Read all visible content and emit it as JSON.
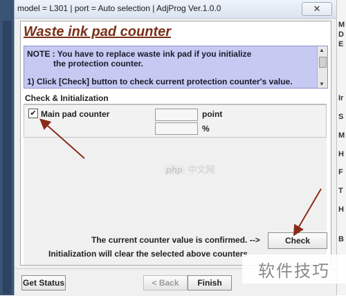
{
  "window": {
    "title": "model = L301 | port = Auto selection | AdjProg Ver.1.0.0",
    "close_glyph": "✕"
  },
  "heading": "Waste ink pad counter",
  "note": {
    "line1": "NOTE : You have to replace waste ink pad if you initialize",
    "line2": "the protection counter.",
    "line3": "1) Click [Check] button to check current protection counter's value."
  },
  "section": {
    "label": "Check & Initialization",
    "rows": [
      {
        "checked": true,
        "check_glyph": "✔",
        "label": "Main pad counter",
        "value1": "",
        "unit1": "point",
        "value2": "",
        "unit2": "%"
      }
    ]
  },
  "confirm_text": "The current counter value is confirmed. -->",
  "check_button": "Check",
  "init_text": "Initialization will clear the selected above counters",
  "bottom": {
    "get_status": "Get Status",
    "back": "< Back",
    "finish": "Finish"
  },
  "right_panel_letters": [
    "M",
    "D",
    "E",
    "Ir",
    "S",
    "M",
    "H",
    "F",
    "T",
    "H",
    "B"
  ],
  "watermarks": {
    "center_logo": "php",
    "center_text": "中文网",
    "corner_text": "软件技巧"
  },
  "colors": {
    "heading": "#7a2f18",
    "note_bg": "#c6caf2",
    "arrow": "#8b2a1a"
  }
}
